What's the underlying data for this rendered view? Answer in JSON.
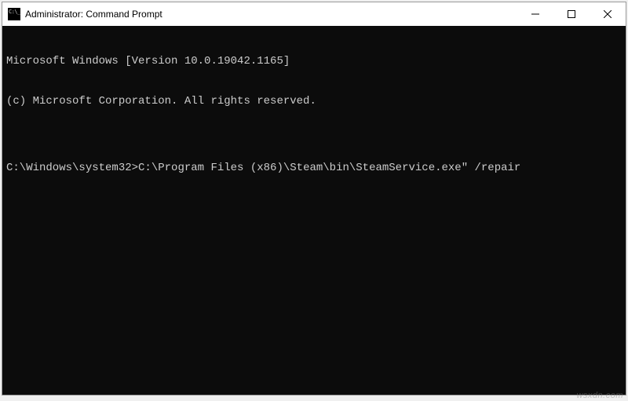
{
  "window": {
    "title": "Administrator: Command Prompt"
  },
  "terminal": {
    "line1": "Microsoft Windows [Version 10.0.19042.1165]",
    "line2": "(c) Microsoft Corporation. All rights reserved.",
    "blank": "",
    "prompt": "C:\\Windows\\system32>",
    "command": "C:\\Program Files (x86)\\Steam\\bin\\SteamService.exe\" /repair"
  },
  "watermark": "wsxdn.com"
}
